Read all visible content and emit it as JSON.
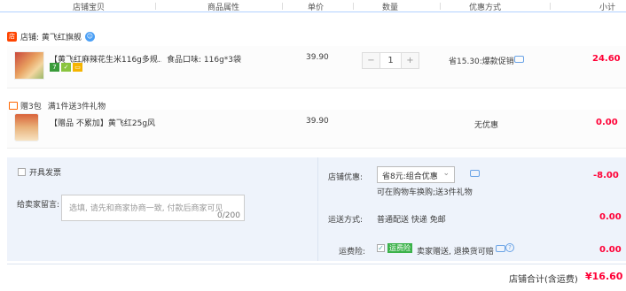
{
  "header": {
    "col_item": "店铺宝贝",
    "col_attr": "商品属性",
    "col_price": "单价",
    "col_qty": "数量",
    "col_promo": "优惠方式",
    "col_subtotal": "小计"
  },
  "shop": {
    "icon": "shop-icon",
    "label": "店铺: 黄飞红旗舰",
    "wangwang_icon": "wangwang-icon"
  },
  "item": {
    "title": "【黄飞红麻辣花生米116g多规...",
    "attr": "食品口味: 116g*3袋",
    "price": "39.90",
    "qty": "1",
    "minus": "−",
    "plus": "+",
    "promo": "省15.30:爆款促销",
    "subtotal": "24.60",
    "badges": [
      "7",
      "✓",
      "▭"
    ]
  },
  "gift_bar": {
    "icon": "gift-icon",
    "tag": "赠3包",
    "desc": "满1件送3件礼物"
  },
  "gift_item": {
    "title": "【赠品 不累加】黄飞红25g风...",
    "price": "39.90",
    "promo": "无优惠",
    "subtotal": "0.00"
  },
  "invoice": {
    "label": "开具发票"
  },
  "message": {
    "label": "给卖家留言:",
    "placeholder": "选填, 请先和商家协商一致, 付款后商家可见",
    "counter": "0/200"
  },
  "shop_discount": {
    "label": "店铺优惠:",
    "selected": "省8元:组合优惠",
    "note": "可在购物车换购;送3件礼物",
    "amount": "-8.00"
  },
  "shipping": {
    "label": "运送方式:",
    "value": "普通配送 快递 免邮",
    "amount": "0.00"
  },
  "insurance": {
    "label": "运费险:",
    "badge": "运费险",
    "desc": "卖家赠送, 退换货可赔",
    "amount": "0.00"
  },
  "total": {
    "label": "店铺合计(含运费)",
    "amount": "¥16.60"
  },
  "colors": {
    "accent_red": "#ff0036",
    "header_line": "#b2d1ff",
    "panel_bg": "#eef3fb",
    "insurance_green": "#3bb24a"
  }
}
